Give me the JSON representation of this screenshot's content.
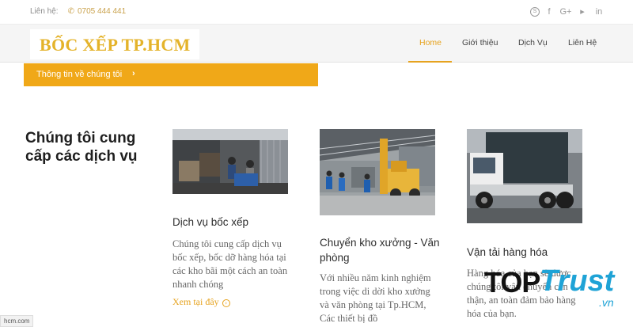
{
  "topbar": {
    "contact_label": "Liên hệ:",
    "phone": "0705 444 441",
    "socials": [
      {
        "icon": "skype-icon",
        "glyph": "S"
      },
      {
        "icon": "facebook-icon",
        "glyph": "f"
      },
      {
        "icon": "google-plus-icon",
        "glyph": "G+"
      },
      {
        "icon": "youtube-icon",
        "glyph": "▸"
      },
      {
        "icon": "linkedin-icon",
        "glyph": "in"
      }
    ]
  },
  "header": {
    "logo_text": "BỐC XẾP TP.HCM",
    "nav": [
      "Home",
      "Giới thiệu",
      "Dịch Vụ",
      "Liên Hệ"
    ],
    "active_nav": "Home"
  },
  "strip": {
    "label": "Thông tin về chúng tôi",
    "chevron": "›"
  },
  "main": {
    "heading": "Chúng tôi cung cấp các dịch vụ"
  },
  "services": [
    {
      "title": "Dịch vụ bốc xếp",
      "description": "Chúng tôi cung cấp dịch vụ bốc xếp, bốc dỡ hàng hóa tại các kho bãi một cách an toàn nhanh chóng",
      "link": "Xem tại đây"
    },
    {
      "title": "Chuyển kho xưởng - Văn phòng",
      "description": "Với nhiều năm kinh nghiệm trong việc di dời kho xưởng và văn phòng tại Tp.HCM, Các thiết bị đồ"
    },
    {
      "title": "Vận tải hàng hóa",
      "description": "Hàng hóa của bạn sẽ được chúng tôi vận chuyển cẩn thận, an toàn đảm bảo hàng hóa của bạn."
    }
  ],
  "watermark": {
    "top": "TOP",
    "trust": "Trust",
    "domain": ".vn"
  },
  "status_bar": {
    "url": "hcm.com"
  },
  "colors": {
    "accent": "#e6a31f",
    "strip": "#f0a818",
    "logo": "#e4b32a",
    "watermark_blue": "#1fa3d6"
  }
}
